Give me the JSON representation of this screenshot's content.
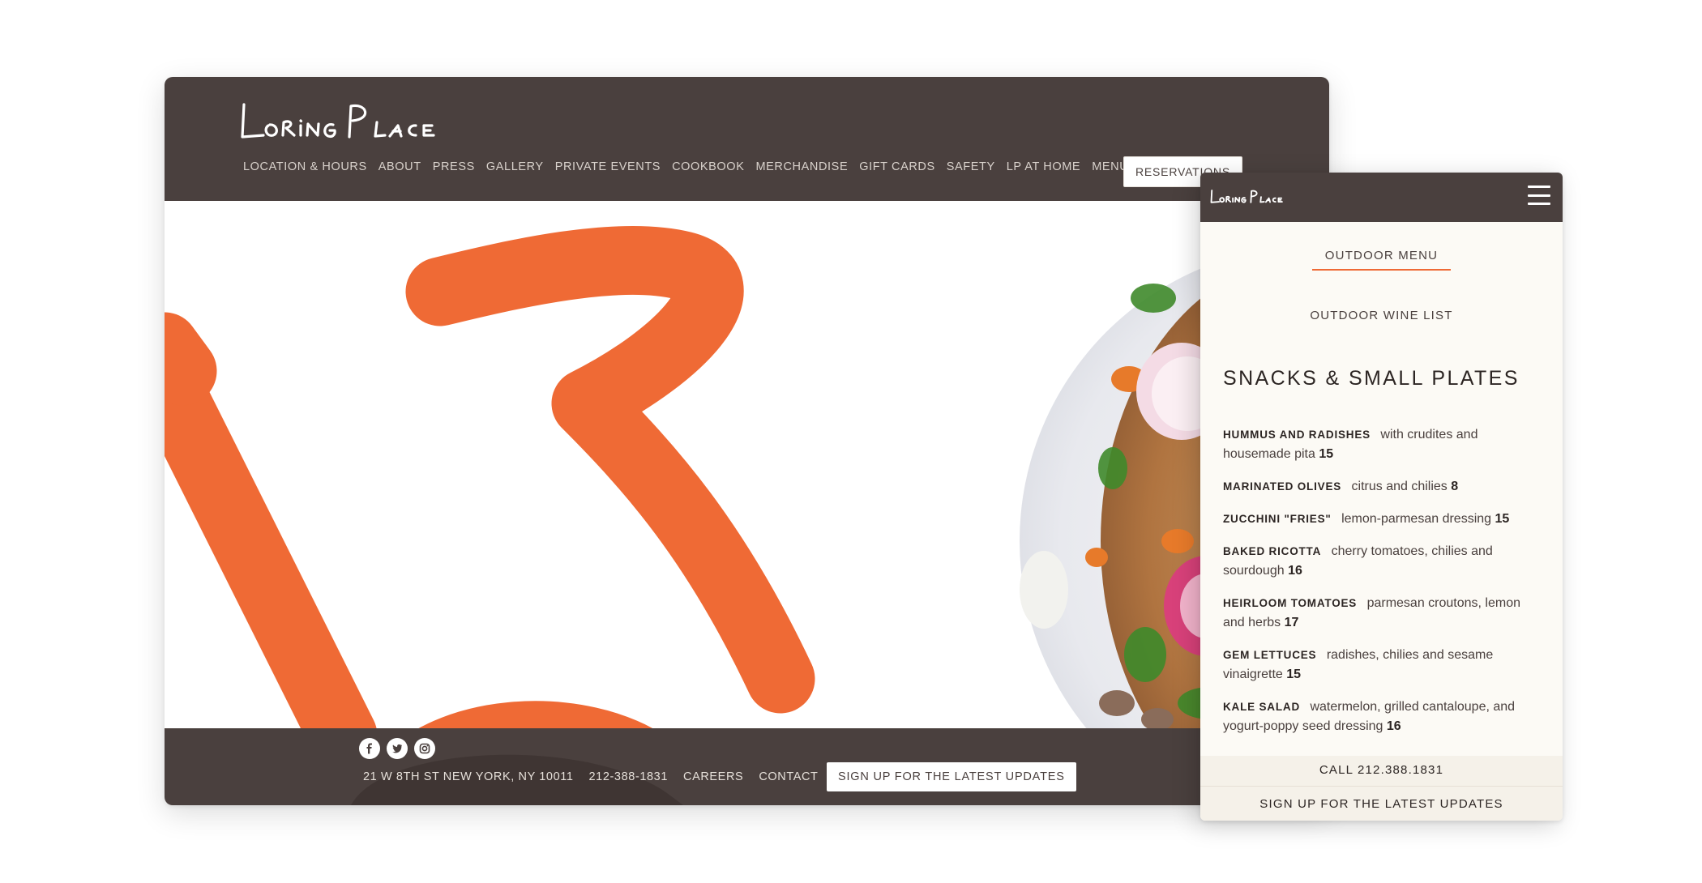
{
  "desktop": {
    "logo_text": "Loring Place",
    "nav": [
      {
        "label": "LOCATION & HOURS",
        "name": "nav-location-hours"
      },
      {
        "label": "ABOUT",
        "name": "nav-about"
      },
      {
        "label": "PRESS",
        "name": "nav-press"
      },
      {
        "label": "GALLERY",
        "name": "nav-gallery"
      },
      {
        "label": "PRIVATE EVENTS",
        "name": "nav-private-events"
      },
      {
        "label": "COOKBOOK",
        "name": "nav-cookbook"
      },
      {
        "label": "MERCHANDISE",
        "name": "nav-merchandise"
      },
      {
        "label": "GIFT CARDS",
        "name": "nav-gift-cards"
      },
      {
        "label": "SAFETY",
        "name": "nav-safety"
      },
      {
        "label": "LP AT HOME",
        "name": "nav-lp-at-home"
      },
      {
        "label": "MENU",
        "name": "nav-menu"
      }
    ],
    "reservations_label": "RESERVATIONS",
    "footer": {
      "social_icons": [
        "facebook-icon",
        "twitter-icon",
        "instagram-icon"
      ],
      "address": "21 W 8TH ST NEW YORK, NY 10011",
      "phone": "212-388-1831",
      "careers": "CAREERS",
      "contact": "CONTACT",
      "signup_label": "SIGN UP FOR THE LATEST UPDATES"
    }
  },
  "mobile": {
    "logo_text": "Loring Place",
    "menu_icon": "hamburger-icon",
    "tabs": {
      "outdoor_menu": "OUTDOOR MENU",
      "outdoor_wine_list": "OUTDOOR WINE LIST"
    },
    "section_title": "SNACKS & SMALL PLATES",
    "items": [
      {
        "name": "HUMMUS AND RADISHES",
        "desc": "with crudites and housemade pita",
        "price": "15"
      },
      {
        "name": "MARINATED OLIVES",
        "desc": "citrus and chilies",
        "price": "8"
      },
      {
        "name": "ZUCCHINI \"FRIES\"",
        "desc": "lemon-parmesan dressing",
        "price": "15"
      },
      {
        "name": "BAKED RICOTTA",
        "desc": "cherry tomatoes, chilies and sourdough",
        "price": "16"
      },
      {
        "name": "HEIRLOOM TOMATOES",
        "desc": "parmesan croutons, lemon and herbs",
        "price": "17"
      },
      {
        "name": "GEM LETTUCES",
        "desc": "radishes, chilies and sesame vinaigrette",
        "price": "15"
      },
      {
        "name": "KALE SALAD",
        "desc": "watermelon, grilled cantaloupe, and yogurt-poppy seed dressing",
        "price": "16"
      }
    ],
    "call_label": "CALL 212.388.1831",
    "signup_label": "SIGN UP FOR THE LATEST UPDATES"
  },
  "colors": {
    "header_brown": "#4a403e",
    "accent_orange": "#ef6a35",
    "cream": "#fcfaf5"
  }
}
